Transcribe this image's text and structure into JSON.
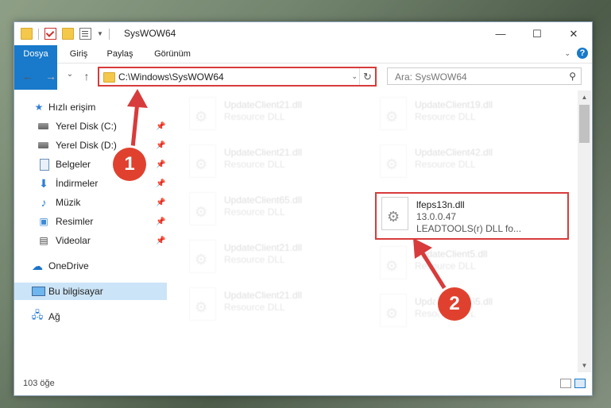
{
  "window": {
    "title": "SysWOW64"
  },
  "window_controls": {
    "minimize": "—",
    "maximize": "☐",
    "close": "✕"
  },
  "ribbon": {
    "tabs": [
      "Dosya",
      "Giriş",
      "Paylaş",
      "Görünüm"
    ],
    "help": "?"
  },
  "nav": {
    "back": "←",
    "forward": "→",
    "recent": "⌄",
    "up": "↑"
  },
  "address": {
    "path": "C:\\Windows\\SysWOW64",
    "refresh": "↻"
  },
  "search": {
    "placeholder": "Ara: SysWOW64"
  },
  "sidebar": {
    "items": [
      {
        "label": "Hızlı erişim",
        "icon": "star-icon"
      },
      {
        "label": "Yerel Disk (C:)",
        "icon": "disk-icon",
        "pinned": true
      },
      {
        "label": "Yerel Disk (D:)",
        "icon": "disk-icon",
        "pinned": true
      },
      {
        "label": "Belgeler",
        "icon": "document-icon",
        "pinned": true
      },
      {
        "label": "İndirmeler",
        "icon": "download-icon",
        "pinned": true
      },
      {
        "label": "Müzik",
        "icon": "music-icon",
        "pinned": true
      },
      {
        "label": "Resimler",
        "icon": "pictures-icon",
        "pinned": true
      },
      {
        "label": "Videolar",
        "icon": "video-icon",
        "pinned": true
      },
      {
        "label": "OneDrive",
        "icon": "cloud-icon"
      },
      {
        "label": "Bu bilgisayar",
        "icon": "computer-icon",
        "selected": true
      },
      {
        "label": "Ağ",
        "icon": "network-icon"
      }
    ]
  },
  "files": [
    {
      "name": "UpdateClient21.dll",
      "desc": "Resource DLL"
    },
    {
      "name": "UpdateClient19.dll",
      "desc": "Resource DLL"
    },
    {
      "name": "UpdateClient21.dll",
      "desc": "Resource DLL"
    },
    {
      "name": "UpdateClient42.dll",
      "desc": "Resource DLL"
    },
    {
      "name": "UpdateClient65.dll",
      "desc": "Resource DLL"
    },
    {
      "name": "lfeps13n.dll",
      "version": "13.0.0.47",
      "desc": "LEADTOOLS(r) DLL fo..."
    },
    {
      "name": "UpdateClient21.dll",
      "desc": "Resource DLL"
    },
    {
      "name": "UpdateClient5.dll",
      "desc": "Resource DLL"
    },
    {
      "name": "UpdateClient21.dll",
      "desc": "Resource DLL"
    },
    {
      "name": "UpdateClient65.dll",
      "desc": "Resource DLL"
    }
  ],
  "status": {
    "count": "103 öğe"
  },
  "callouts": [
    "1",
    "2"
  ],
  "colors": {
    "accent": "#1979ca",
    "highlight": "#d83b3b",
    "badge": "#e0412f"
  }
}
